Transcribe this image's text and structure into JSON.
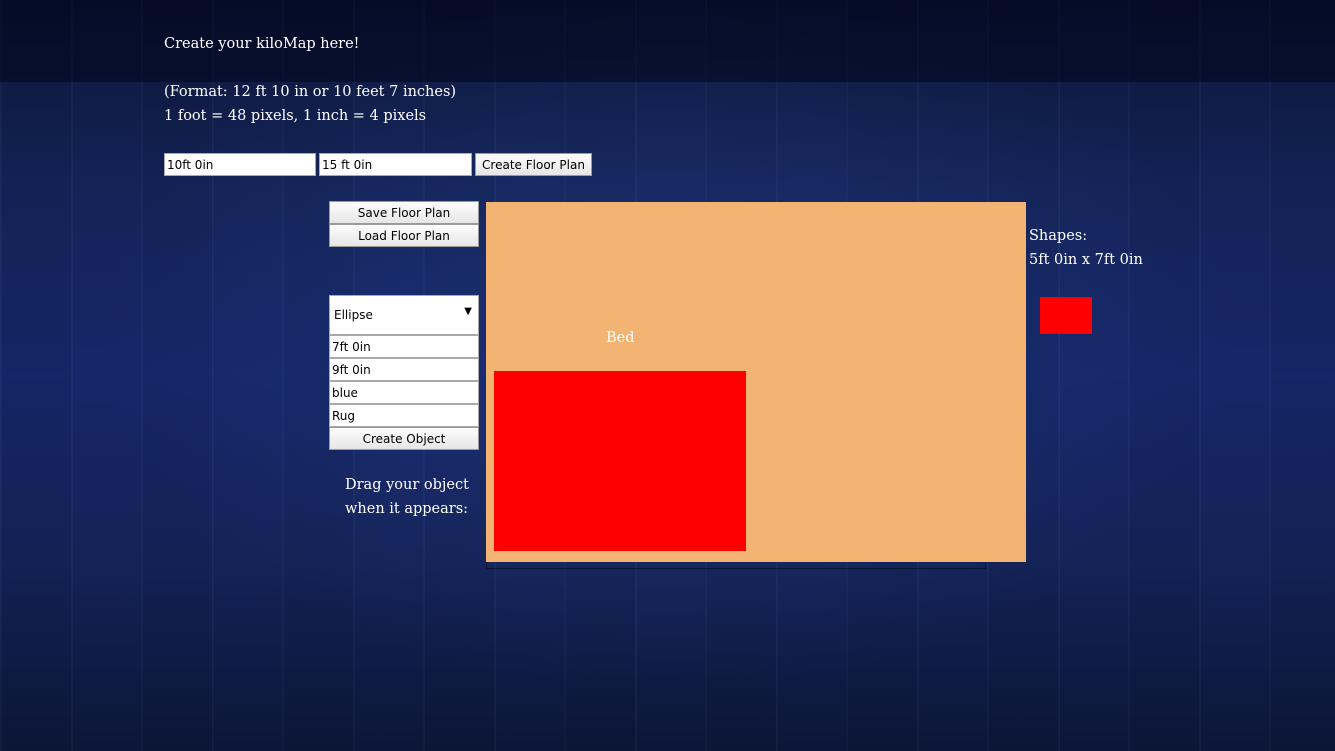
{
  "header": {
    "title": "Create your kiloMap here!",
    "format_hint": "(Format: 12 ft 10 in or 10 feet 7 inches)",
    "scale_hint": "1 foot = 48 pixels, 1 inch = 4 pixels"
  },
  "floor_form": {
    "width_value": "10ft 0in",
    "length_value": "15 ft 0in",
    "create_label": "Create Floor Plan"
  },
  "file_actions": {
    "save_label": "Save Floor Plan",
    "load_label": "Load Floor Plan"
  },
  "object_form": {
    "shape_selected": "Ellipse",
    "width_value": "7ft 0in",
    "length_value": "9ft 0in",
    "color_value": "blue",
    "name_value": "Rug",
    "create_label": "Create Object",
    "drag_hint_line1": "Drag your object",
    "drag_hint_line2": "when it appears:"
  },
  "canvas": {
    "object_label": "Bed",
    "floor_color": "#f3b372",
    "object_color": "#ff0000"
  },
  "shapes_panel": {
    "heading": "Shapes:",
    "dimensions": "5ft 0in x 7ft 0in",
    "swatch_color": "#ff0000"
  },
  "icons": {
    "dropdown_arrow": "chevron-down-icon"
  }
}
